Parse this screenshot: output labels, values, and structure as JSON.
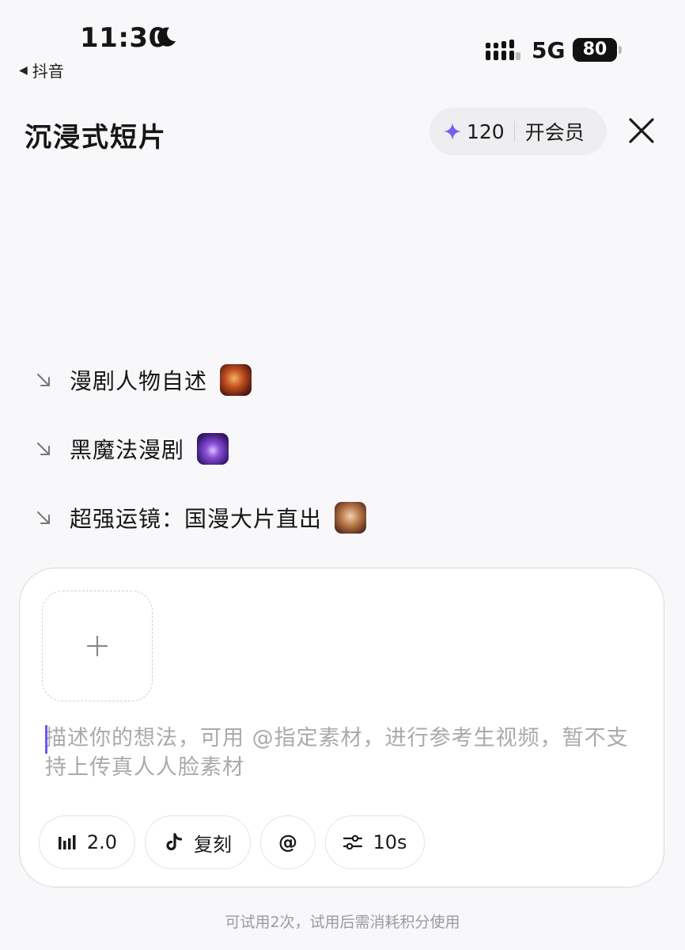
{
  "status_bar": {
    "time": "11:30",
    "back_app": "抖音",
    "network": "5G",
    "battery": "80"
  },
  "header": {
    "title": "沉浸式短片",
    "credits": "120",
    "vip_label": "开会员",
    "accent_color": "#7b5cf5"
  },
  "suggestions": [
    {
      "label": "漫剧人物自述"
    },
    {
      "label": "黑魔法漫剧"
    },
    {
      "label": "超强运镜：国漫大片直出"
    }
  ],
  "composer": {
    "placeholder": "描述你的想法，可用 @指定素材，进行参考生视频，暂不支持上传真人人脸素材",
    "chips": {
      "model": "2.0",
      "copy": "复刻",
      "mention": "@",
      "duration": "10s"
    }
  },
  "footer_note": "可试用2次，试用后需消耗积分使用"
}
